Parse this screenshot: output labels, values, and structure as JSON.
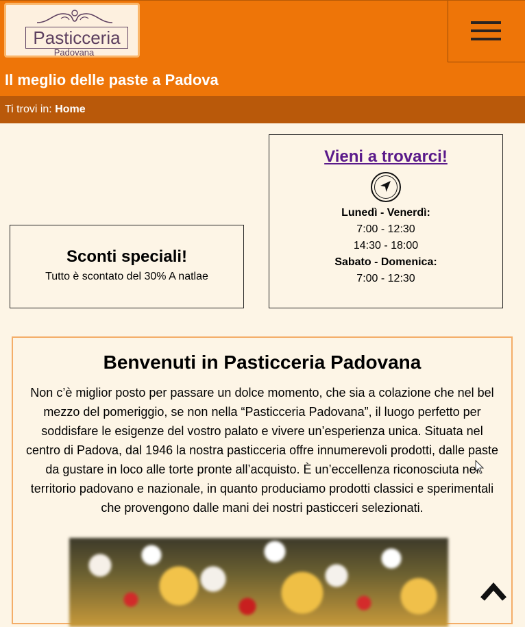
{
  "header": {
    "logo": {
      "name": "Pasticceria",
      "subtitle": "Padovana"
    },
    "tagline": "Il meglio delle paste a Padova",
    "menu_icon": "hamburger-menu-icon"
  },
  "breadcrumb": {
    "prefix": "Ti trovi in:",
    "current": "Home"
  },
  "offer": {
    "title": "Sconti speciali!",
    "text": "Tutto è scontato del 30% A natlae"
  },
  "visit": {
    "link": "Vieni a trovarci!",
    "icon": "navigation-icon",
    "hours": [
      {
        "label": "Lunedì - Venerdì:",
        "times": [
          "7:00 - 12:30",
          "14:30 - 18:00"
        ]
      },
      {
        "label": "Sabato - Domenica:",
        "times": [
          "7:00 - 12:30"
        ]
      }
    ]
  },
  "welcome": {
    "title": "Benvenuti in Pasticceria Padovana",
    "text": "Non c’è miglior posto per passare un dolce momento, che sia a colazione che nel bel mezzo del pomeriggio, se non nella “Pasticceria Padovana”, il luogo perfetto per soddisfare le esigenze del vostro palato e vivere un’esperienza unica. Situata nel centro di Padova, dal 1946 la nostra pasticceria offre innumerevoli prodotti, dalle paste da gustare in loco alle torte pronte all’acquisto. È un’eccellenza riconosciuta nel territorio padovano e nazionale, in quanto produciamo prodotti classici e sperimentali che provengono dalle mani dei nostri pasticceri selezionati."
  },
  "back_to_top_icon": "chevron-up-icon",
  "colors": {
    "header": "#ee7508",
    "breadcrumb": "#b9590a",
    "background": "#fdf5e6",
    "link": "#5a1a8a"
  }
}
